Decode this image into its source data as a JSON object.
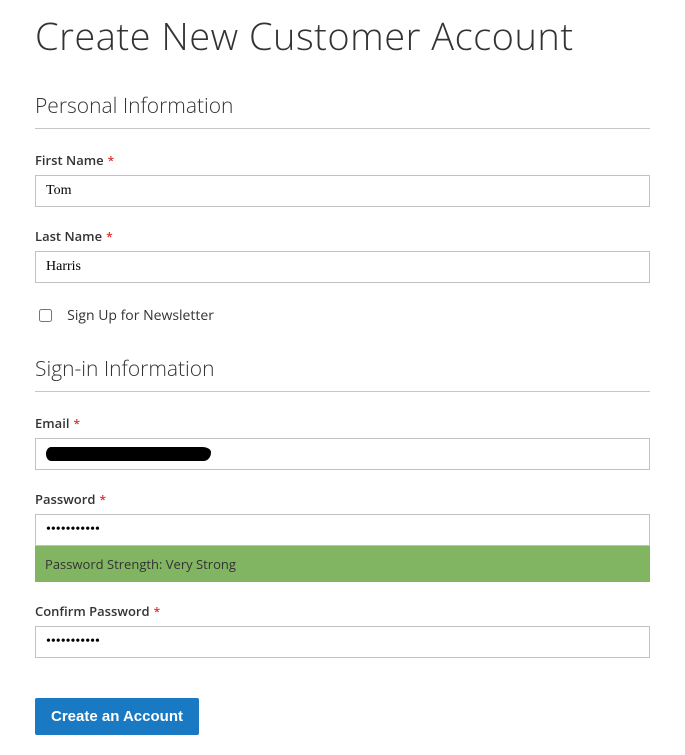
{
  "page_title": "Create New Customer Account",
  "sections": {
    "personal": {
      "legend": "Personal Information",
      "first_name_label": "First Name",
      "first_name_value": "Tom",
      "last_name_label": "Last Name",
      "last_name_value": "Harris",
      "newsletter_label": "Sign Up for Newsletter",
      "newsletter_checked": false
    },
    "signin": {
      "legend": "Sign-in Information",
      "email_label": "Email",
      "email_value": "",
      "password_label": "Password",
      "password_value": "•••••••••••",
      "password_strength_label": "Password Strength: Very Strong",
      "confirm_password_label": "Confirm Password",
      "confirm_password_value": "•••••••••••"
    }
  },
  "submit_label": "Create an Account",
  "required_mark": "*",
  "colors": {
    "primary": "#1979c3",
    "required": "#e02b27",
    "strength_bg": "#81b562"
  }
}
